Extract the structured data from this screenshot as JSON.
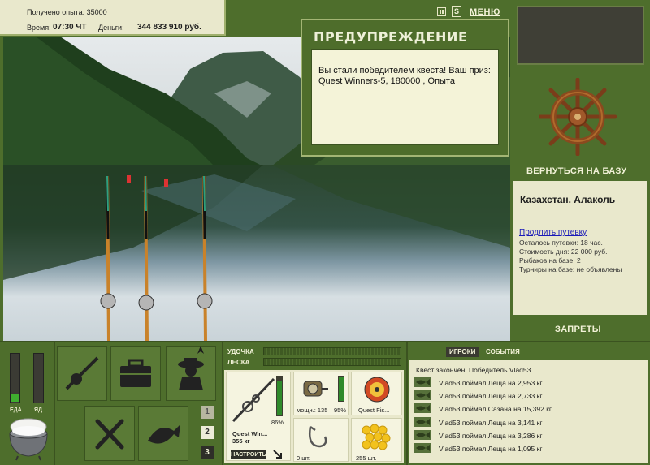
{
  "status": {
    "xp": "Получено опыта: 35000",
    "time_label": "Время:",
    "time_value": "07:30 ЧТ",
    "money_label": "Деньги:",
    "money_value": "344 833 910 руб."
  },
  "topbar": {
    "sound": "S",
    "menu": "МЕНЮ"
  },
  "warning": {
    "title": "ПРЕДУПРЕЖДЕНИЕ",
    "message": "Вы стали победителем квеста! Ваш приз: Quest Winners-5, 180000 , Опыта"
  },
  "sidebar": {
    "return_base": "ВЕРНУТЬСЯ НА БАЗУ",
    "location": "Казахстан. Алаколь",
    "extend_link": "Продлить путевку",
    "info": [
      "Осталось путевки: 18 час.",
      "Стоимость дня: 22 000 руб.",
      "Рыбаков на базе: 2",
      "Турниры на базе: не объявлены"
    ],
    "bans": "ЗАПРЕТЫ"
  },
  "needs": {
    "eat_label": "ЕДА",
    "poison_label": "ЯД",
    "eat_level": 0.15,
    "poison_level": 0
  },
  "pages": [
    "1",
    "2",
    "3"
  ],
  "tackle": {
    "rod_label": "УДОЧКА",
    "line_label": "ЛЕСКА",
    "rod_name": "Quest Win...",
    "rod_weight": "355 кг",
    "rod_percent": "86%",
    "reel_text": "мощн.: 135",
    "reel_percent": "95%",
    "line_name": "Quest Fis...",
    "hook_count": "0 шт.",
    "bait_count": "255 шт.",
    "tune_button": "НАСТРОИТЬ",
    "rod_meter": 0.86,
    "reel_meter": 0.95
  },
  "events": {
    "tab_players": "ИГРОКИ",
    "tab_events": "СОБЫТИЯ",
    "header": "Квест закончен! Победитель Vlad53",
    "rows": [
      "Vlad53 поймал Леща на 2,953 кг",
      "Vlad53 поймал Леща на 2,733 кг",
      "Vlad53 поймал Сазана на 15,392 кг",
      "Vlad53 поймал Леща на 3,141 кг",
      "Vlad53 поймал Леща на 3,286 кг",
      "Vlad53 поймал Леща на 1,095 кг"
    ]
  }
}
